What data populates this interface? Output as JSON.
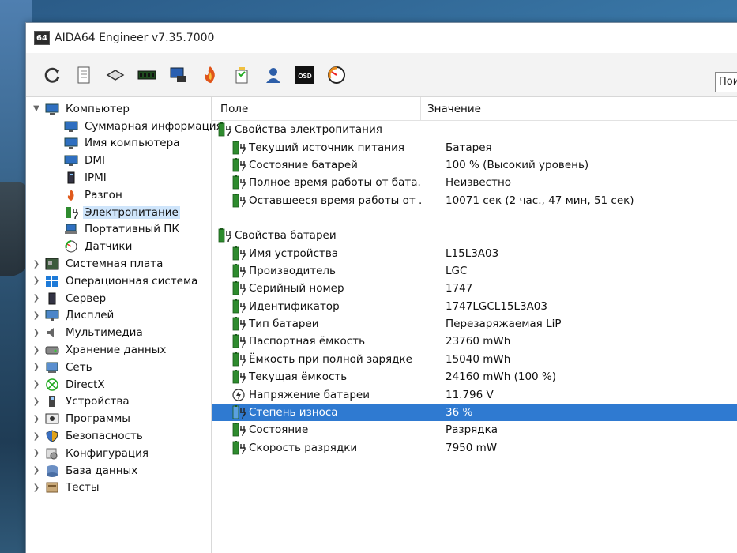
{
  "window": {
    "title": "AIDA64 Engineer v7.35.7000",
    "logo_text": "64"
  },
  "toolbar": {
    "buttons": [
      {
        "name": "refresh-icon"
      },
      {
        "name": "report-icon"
      },
      {
        "name": "motherboard-icon"
      },
      {
        "name": "memory-icon"
      },
      {
        "name": "network-share-icon"
      },
      {
        "name": "aida-flame-icon"
      },
      {
        "name": "favorites-icon"
      },
      {
        "name": "user-icon"
      },
      {
        "name": "osd-icon",
        "label": "OSD"
      },
      {
        "name": "sensor-icon"
      }
    ],
    "search_text": "Поиск"
  },
  "tree": {
    "items": [
      {
        "label": "Компьютер",
        "level": "top",
        "expanded": true,
        "icon": "computer-icon"
      },
      {
        "label": "Суммарная информация",
        "level": "child",
        "icon": "computer-icon"
      },
      {
        "label": "Имя компьютера",
        "level": "child",
        "icon": "computer-icon"
      },
      {
        "label": "DMI",
        "level": "child",
        "icon": "computer-icon"
      },
      {
        "label": "IPMI",
        "level": "child",
        "icon": "server-icon"
      },
      {
        "label": "Разгон",
        "level": "child",
        "icon": "flame-icon"
      },
      {
        "label": "Электропитание",
        "level": "child",
        "icon": "battery-icon",
        "selected": true
      },
      {
        "label": "Портативный ПК",
        "level": "child",
        "icon": "laptop-icon"
      },
      {
        "label": "Датчики",
        "level": "child",
        "icon": "gauge-icon"
      },
      {
        "label": "Системная плата",
        "level": "top",
        "icon": "motherboard-icon"
      },
      {
        "label": "Операционная система",
        "level": "top",
        "icon": "windows-icon"
      },
      {
        "label": "Сервер",
        "level": "top",
        "icon": "server-icon"
      },
      {
        "label": "Дисплей",
        "level": "top",
        "icon": "monitor-icon"
      },
      {
        "label": "Мультимедиа",
        "level": "top",
        "icon": "speaker-icon"
      },
      {
        "label": "Хранение данных",
        "level": "top",
        "icon": "disk-icon"
      },
      {
        "label": "Сеть",
        "level": "top",
        "icon": "network-icon"
      },
      {
        "label": "DirectX",
        "level": "top",
        "icon": "xbox-icon"
      },
      {
        "label": "Устройства",
        "level": "top",
        "icon": "device-icon"
      },
      {
        "label": "Программы",
        "level": "top",
        "icon": "programs-icon"
      },
      {
        "label": "Безопасность",
        "level": "top",
        "icon": "shield-icon"
      },
      {
        "label": "Конфигурация",
        "level": "top",
        "icon": "config-icon"
      },
      {
        "label": "База данных",
        "level": "top",
        "icon": "database-icon"
      },
      {
        "label": "Тесты",
        "level": "top",
        "icon": "tests-icon"
      }
    ]
  },
  "grid": {
    "header_field": "Поле",
    "header_value": "Значение",
    "groups": [
      {
        "title": "Свойства электропитания",
        "rows": [
          {
            "field": "Текущий источник питания",
            "value": "Батарея"
          },
          {
            "field": "Состояние батарей",
            "value": "100 % (Высокий уровень)"
          },
          {
            "field": "Полное время работы от бата...",
            "value": "Неизвестно"
          },
          {
            "field": "Оставшееся время работы от ...",
            "value": "10071 сек (2 час., 47 мин, 51 сек)"
          }
        ]
      },
      {
        "title": "Свойства батареи",
        "rows": [
          {
            "field": "Имя устройства",
            "value": "L15L3A03"
          },
          {
            "field": "Производитель",
            "value": "LGC"
          },
          {
            "field": "Серийный номер",
            "value": "1747"
          },
          {
            "field": "Идентификатор",
            "value": "1747LGCL15L3A03"
          },
          {
            "field": "Тип батареи",
            "value": "Перезаряжаемая LiP"
          },
          {
            "field": "Паспортная ёмкость",
            "value": "23760 mWh"
          },
          {
            "field": "Ёмкость при полной зарядке",
            "value": "15040 mWh"
          },
          {
            "field": "Текущая ёмкость",
            "value": "24160 mWh  (100 %)"
          },
          {
            "field": "Напряжение батареи",
            "value": "11.796 V",
            "icon": "voltage-icon"
          },
          {
            "field": "Степень износа",
            "value": "36 %",
            "selected": true
          },
          {
            "field": "Состояние",
            "value": "Разрядка"
          },
          {
            "field": "Скорость разрядки",
            "value": "7950 mW"
          }
        ]
      }
    ]
  },
  "colors": {
    "selection": "#2f7ad1",
    "tree_selection": "#cfe5fb",
    "battery_green": "#2e8b2e"
  }
}
